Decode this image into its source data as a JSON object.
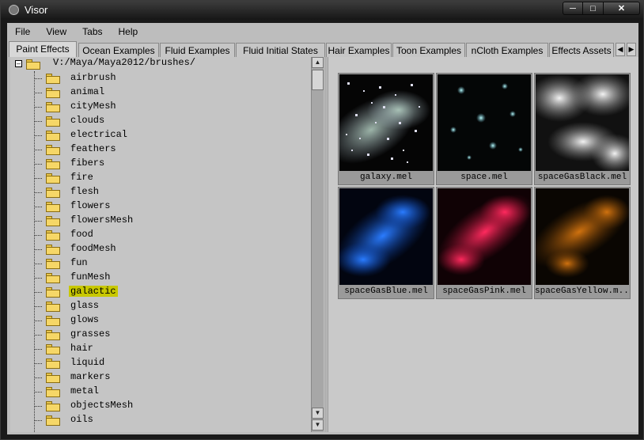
{
  "window": {
    "title": "Visor"
  },
  "menu": [
    "File",
    "View",
    "Tabs",
    "Help"
  ],
  "tabs": [
    "Paint Effects",
    "Ocean Examples",
    "Fluid Examples",
    "Fluid Initial States",
    "Hair Examples",
    "Toon Examples",
    "nCloth Examples",
    "Effects Assets"
  ],
  "active_tab": "Paint Effects",
  "tree": {
    "root_path": "V:/Maya/Maya2012/brushes/",
    "items": [
      "airbrush",
      "animal",
      "cityMesh",
      "clouds",
      "electrical",
      "feathers",
      "fibers",
      "fire",
      "flesh",
      "flowers",
      "flowersMesh",
      "food",
      "foodMesh",
      "fun",
      "funMesh",
      "galactic",
      "glass",
      "glows",
      "grasses",
      "hair",
      "liquid",
      "markers",
      "metal",
      "objectsMesh",
      "oils"
    ],
    "selected": "galactic"
  },
  "thumbnails": [
    {
      "name": "galaxy.mel",
      "icon": "galaxy-preview"
    },
    {
      "name": "space.mel",
      "icon": "space-preview"
    },
    {
      "name": "spaceGasBlack.mel",
      "icon": "gas-black-preview"
    },
    {
      "name": "spaceGasBlue.mel",
      "icon": "gas-blue-preview"
    },
    {
      "name": "spaceGasPink.mel",
      "icon": "gas-pink-preview"
    },
    {
      "name": "spaceGasYellow.m...",
      "icon": "gas-yellow-preview"
    }
  ],
  "colors": {
    "selection": "#c8c800",
    "folder": "#f6d767",
    "panel": "#c5c5c5"
  }
}
